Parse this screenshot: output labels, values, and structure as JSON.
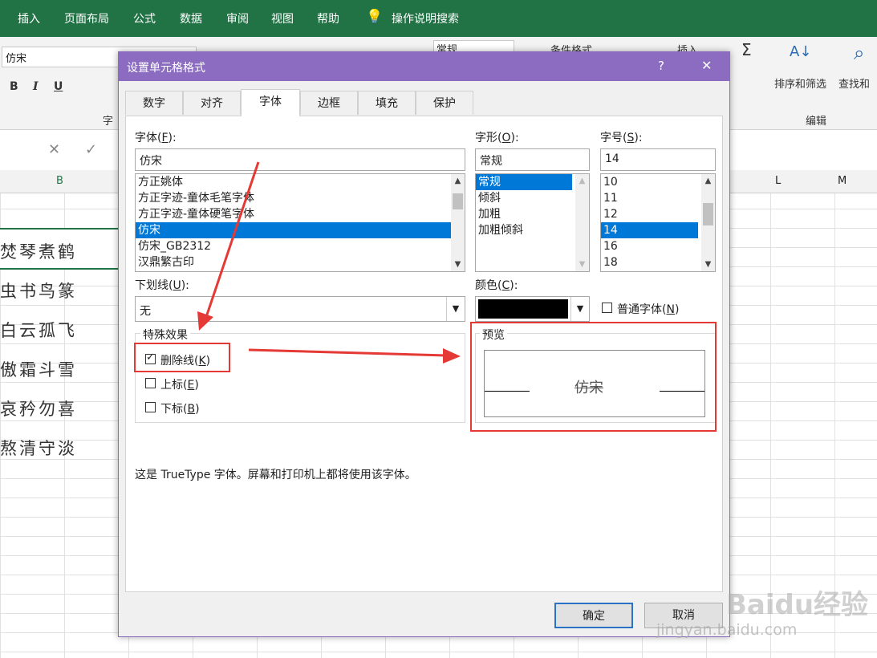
{
  "ribbon": {
    "tabs": [
      "插入",
      "页面布局",
      "公式",
      "数据",
      "审阅",
      "视图",
      "帮助"
    ],
    "tell_me": "操作说明搜索",
    "font_value": "仿宋",
    "bold": "B",
    "italic": "I",
    "underline": "U",
    "font_group_label": "字",
    "number_format": "常规",
    "conditional_format": "条件格式",
    "insert": "插入",
    "sort_filter": "排序和筛选",
    "find_select": "查找和",
    "edit_group": "编辑"
  },
  "sheet": {
    "col_b": "B",
    "col_l": "L",
    "col_m": "M",
    "cells": [
      "焚琴煮鹤",
      "虫书鸟篆",
      "白云孤飞",
      "傲霜斗雪",
      "哀矜勿喜",
      "熬清守淡"
    ]
  },
  "dialog": {
    "title": "设置单元格格式",
    "help": "?",
    "close": "✕",
    "tabs": [
      "数字",
      "对齐",
      "字体",
      "边框",
      "填充",
      "保护"
    ],
    "font": {
      "label": "字体(",
      "key": "F",
      "label_end": "):",
      "value": "仿宋",
      "items": [
        "方正姚体",
        "方正字迹-童体毛笔字体",
        "方正字迹-童体硬笔字体",
        "仿宋",
        "仿宋_GB2312",
        "汉鼎繁古印"
      ],
      "selected_index": 3
    },
    "style": {
      "label": "字形(",
      "key": "O",
      "label_end": "):",
      "value": "常规",
      "items": [
        "常规",
        "倾斜",
        "加粗",
        "加粗倾斜"
      ],
      "selected_index": 0
    },
    "size": {
      "label": "字号(",
      "key": "S",
      "label_end": "):",
      "value": "14",
      "items": [
        "10",
        "11",
        "12",
        "14",
        "16",
        "18"
      ],
      "selected_index": 3
    },
    "underline": {
      "label": "下划线(",
      "key": "U",
      "label_end": "):",
      "value": "无"
    },
    "color": {
      "label": "颜色(",
      "key": "C",
      "label_end": "):",
      "value": "#000000"
    },
    "normal_font": {
      "label": "普通字体(",
      "key": "N",
      "label_end": ")",
      "checked": false
    },
    "effects": {
      "title": "特殊效果",
      "strikethrough": {
        "label": "删除线(",
        "key": "K",
        "label_end": ")",
        "checked": true
      },
      "superscript": {
        "label": "上标(",
        "key": "E",
        "label_end": ")",
        "checked": false
      },
      "subscript": {
        "label": "下标(",
        "key": "B",
        "label_end": ")",
        "checked": false
      }
    },
    "preview": {
      "title": "预览",
      "sample": "仿宋"
    },
    "note": "这是 TrueType 字体。屏幕和打印机上都将使用该字体。",
    "ok": "确定",
    "cancel": "取消"
  },
  "annotation_color": "#e53935",
  "watermark": {
    "brand": "Baidu经验",
    "url": "jingyan.baidu.com"
  }
}
